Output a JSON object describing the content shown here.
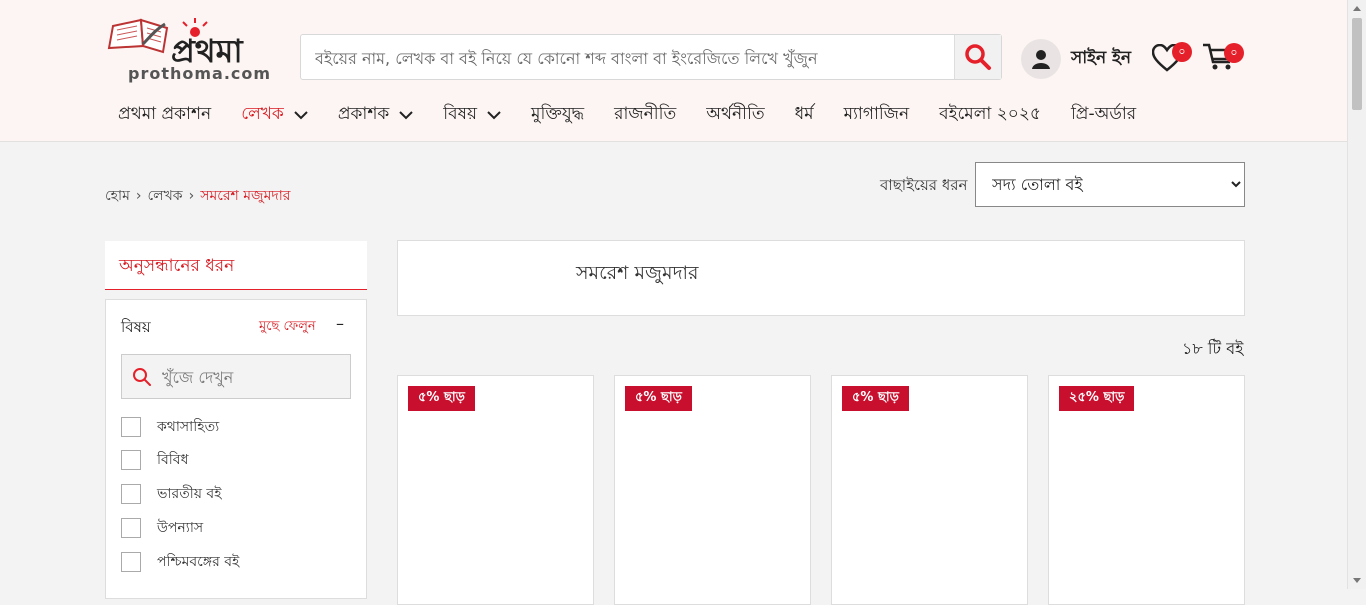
{
  "brand": {
    "logo_text": "prothoma.com",
    "accent": "#e5202a"
  },
  "search": {
    "placeholder": "বইয়ের নাম, লেখক বা বই নিয়ে যে কোনো শব্দ বাংলা বা ইংরেজিতে লিখে খুঁজুন"
  },
  "account": {
    "signin_label": "সাইন ইন",
    "wishlist_count": "০",
    "cart_count": "০"
  },
  "nav": {
    "items": [
      {
        "label": "প্রথমা প্রকাশন",
        "has_menu": false
      },
      {
        "label": "লেখক",
        "has_menu": true,
        "active": true
      },
      {
        "label": "প্রকাশক",
        "has_menu": true
      },
      {
        "label": "বিষয়",
        "has_menu": true
      },
      {
        "label": "মুক্তিযুদ্ধ",
        "has_menu": false
      },
      {
        "label": "রাজনীতি",
        "has_menu": false
      },
      {
        "label": "অর্থনীতি",
        "has_menu": false
      },
      {
        "label": "ধর্ম",
        "has_menu": false
      },
      {
        "label": "ম্যাগাজিন",
        "has_menu": false
      },
      {
        "label": "বইমেলা ২০২৫",
        "has_menu": false
      },
      {
        "label": "প্রি-অর্ডার",
        "has_menu": false
      }
    ]
  },
  "breadcrumb": {
    "home": "হোম",
    "section": "লেখক",
    "current": "সমরেশ মজুমদার"
  },
  "sort": {
    "label": "বাছাইয়ের ধরন",
    "selected": "সদ্য তোলা বই"
  },
  "filter": {
    "heading": "অনুসন্ধানের ধরন",
    "group_title": "বিষয়",
    "clear_label": "মুছে ফেলুন",
    "collapse_symbol": "–",
    "search_placeholder": "খুঁজে দেখুন",
    "options": [
      "কথাসাহিত্য",
      "বিবিধ",
      "ভারতীয় বই",
      "উপন্যাস",
      "পশ্চিমবঙ্গের বই"
    ]
  },
  "author": {
    "name": "সমরেশ মজুমদার"
  },
  "results": {
    "count_label": "১৮ টি বই"
  },
  "products": [
    {
      "discount": "৫% ছাড়"
    },
    {
      "discount": "৫% ছাড়"
    },
    {
      "discount": "৫% ছাড়"
    },
    {
      "discount": "২৫% ছাড়"
    }
  ]
}
